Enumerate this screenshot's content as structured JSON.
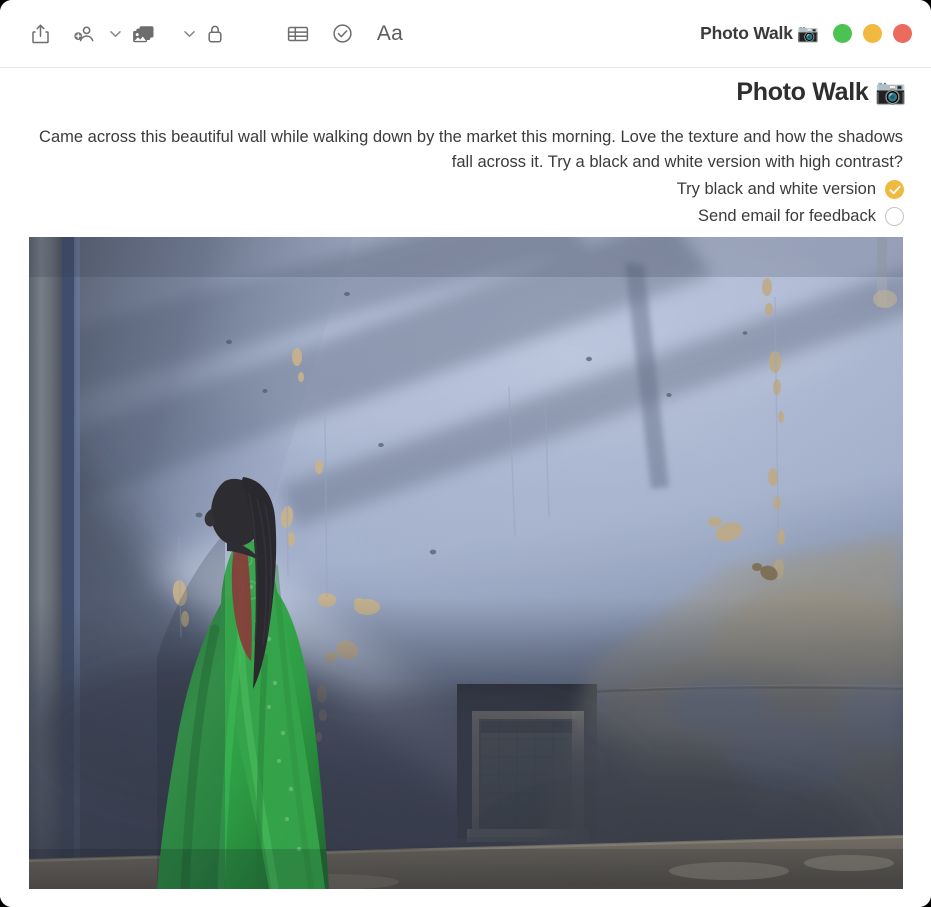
{
  "window": {
    "traffic_lights": [
      {
        "name": "minimize-or-zoom-green",
        "color": "#4cc252"
      },
      {
        "name": "minimize-yellow",
        "color": "#f0b93f"
      },
      {
        "name": "close-red",
        "color": "#ed6a5e"
      }
    ]
  },
  "toolbar": {
    "title": "Photo Walk 📷",
    "buttons": [
      {
        "name": "share-icon",
        "label": "Share"
      },
      {
        "name": "add-people-icon",
        "label": "Add People"
      },
      {
        "name": "media-chevron-icon",
        "label": "Media options"
      },
      {
        "name": "media-icon",
        "label": "Media"
      },
      {
        "name": "lock-chevron-icon",
        "label": "Lock options"
      },
      {
        "name": "lock-icon",
        "label": "Lock Note"
      },
      {
        "name": "table-icon",
        "label": "Table"
      },
      {
        "name": "checklist-icon",
        "label": "Checklist"
      },
      {
        "name": "format-text-icon",
        "label": "Aa"
      }
    ],
    "format_label": "Aa"
  },
  "note": {
    "title": "Photo Walk 📷",
    "paragraph": "Came across this beautiful wall while walking down by the market this morning. Love the texture and how the shadows fall across it. Try a black and white version with high contrast?",
    "checklist": [
      {
        "label": "Try black and white version",
        "checked": true
      },
      {
        "label": "Send email for feedback",
        "checked": false
      }
    ],
    "attachment": {
      "name": "photo-attachment",
      "description": "Photograph of a woman in a green sari walking past a weathered blue painted wall with a small window and diagonal cable shadows"
    }
  },
  "colors": {
    "accent_checked": "#f0b93f",
    "text": "#3b3b3b",
    "title": "#2e2e2e",
    "toolbar_icon": "#6d6d6d",
    "separator": "#e6e6e6"
  }
}
